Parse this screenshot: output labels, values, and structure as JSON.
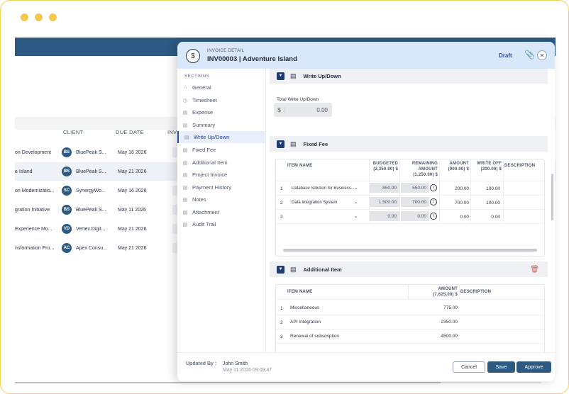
{
  "background": {
    "headers": {
      "client": "CLIENT",
      "due_date": "DUE DATE",
      "inv": "INV"
    },
    "rows": [
      {
        "project": "on Development",
        "initials": "BS",
        "client": "BluePeak S...",
        "due": "May 16 2026"
      },
      {
        "project": "e Island",
        "initials": "BS",
        "client": "BluePeak S...",
        "due": "May 21 2026"
      },
      {
        "project": "on Modernizatio...",
        "initials": "SC",
        "client": "SynergyWo...",
        "due": "May 16 2026"
      },
      {
        "project": "gration Initiative",
        "initials": "BS",
        "client": "BluePeak S...",
        "due": "May 11 2026"
      },
      {
        "project": "Experience Mo...",
        "initials": "VD",
        "client": "Vertex Digit...",
        "due": "May 21 2026"
      },
      {
        "project": "nsformation Pro...",
        "initials": "AC",
        "client": "Apex Consu...",
        "due": "May 21 2026"
      }
    ]
  },
  "panel": {
    "subtitle": "INVOICE DETAIL",
    "title": "INV00003 | Adventure Island",
    "status": "Draft"
  },
  "sections": {
    "title": "SECTIONS",
    "items": [
      {
        "label": "General",
        "icon": "home-icon"
      },
      {
        "label": "Timesheet",
        "icon": "clock-icon"
      },
      {
        "label": "Expense",
        "icon": "doc-icon"
      },
      {
        "label": "Summary",
        "icon": "doc-icon"
      },
      {
        "label": "Write Up/Down",
        "icon": "doc-icon",
        "active": true
      },
      {
        "label": "Fixed Fee",
        "icon": "doc-icon"
      },
      {
        "label": "Additional Item",
        "icon": "doc-icon"
      },
      {
        "label": "Project Invoice",
        "icon": "doc-icon"
      },
      {
        "label": "Payment History",
        "icon": "doc-icon"
      },
      {
        "label": "Notes",
        "icon": "doc-icon"
      },
      {
        "label": "Attachment",
        "icon": "doc-icon"
      },
      {
        "label": "Audit Trail",
        "icon": "doc-icon"
      }
    ]
  },
  "write_up_down": {
    "label": "Write Up/Down",
    "total_label": "Total Write Up/Down",
    "currency": "$",
    "total_value": "0.00"
  },
  "fixed_fee": {
    "label": "Fixed Fee",
    "headers": {
      "item": "ITEM NAME",
      "budgeted": "BUDGETED (2,350.00) $",
      "remaining": "REMAINING AMOUNT (1,250.00) $",
      "amount": "AMOUNT (900.00) $",
      "writeoff": "WRITE OFF (200.00) $",
      "description": "DESCRIPTION"
    },
    "rows": [
      {
        "no": "1",
        "item": "Database Solution for Business...",
        "budgeted": "850.00",
        "remaining": "550.00",
        "amount": "200.00",
        "writeoff": "100.00"
      },
      {
        "no": "2",
        "item": "Data Integration System",
        "budgeted": "1,500.00",
        "remaining": "700.00",
        "amount": "700.00",
        "writeoff": "100.00"
      },
      {
        "no": "3",
        "item": "",
        "budgeted": "0.00",
        "remaining": "0.00",
        "amount": "0.00",
        "writeoff": "0.00"
      }
    ]
  },
  "additional_item": {
    "label": "Additional Item",
    "headers": {
      "item": "ITEM NAME",
      "amount": "AMOUNT (7,625.00) $",
      "description": "DESCRIPTION"
    },
    "rows": [
      {
        "no": "1",
        "item": "Miscellaneous",
        "amount": "775.00"
      },
      {
        "no": "2",
        "item": "API Integration",
        "amount": "2350.00"
      },
      {
        "no": "3",
        "item": "Renewal of subscription",
        "amount": "4500.00"
      }
    ]
  },
  "footer": {
    "updated_label": "Updated By :",
    "updated_name": "John Smith",
    "updated_date": "May 11 2026 09:09:47",
    "cancel": "Cancel",
    "save": "Save",
    "approve": "Approve"
  }
}
